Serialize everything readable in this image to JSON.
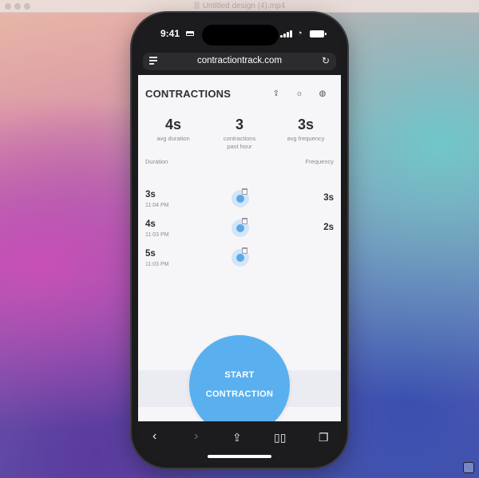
{
  "window": {
    "title": "Untitled design (4).mp4"
  },
  "status_bar": {
    "time": "9:41"
  },
  "browser": {
    "url": "contractiontrack.com"
  },
  "app": {
    "title": "CONTRACTIONS",
    "stats": [
      {
        "value": "4s",
        "label": "avg duration"
      },
      {
        "value": "3",
        "label": "contractions past hour"
      },
      {
        "value": "3s",
        "label": "avg frequency"
      }
    ],
    "columns": {
      "duration": "Duration",
      "frequency": "Frequency"
    },
    "rows": [
      {
        "duration": "3s",
        "time": "11:04 PM",
        "frequency": "3s"
      },
      {
        "duration": "4s",
        "time": "11:03 PM",
        "frequency": "2s"
      },
      {
        "duration": "5s",
        "time": "11:03 PM",
        "frequency": ""
      }
    ],
    "start_button": {
      "line1": "START",
      "line2": "CONTRACTION"
    }
  },
  "colors": {
    "accent": "#5aafef",
    "background": "#f6f6f9"
  },
  "icons": [
    "share-icon",
    "brightness-icon",
    "globe-icon",
    "trash-icon",
    "back-icon",
    "forward-icon",
    "bookmarks-icon",
    "tabs-icon"
  ]
}
